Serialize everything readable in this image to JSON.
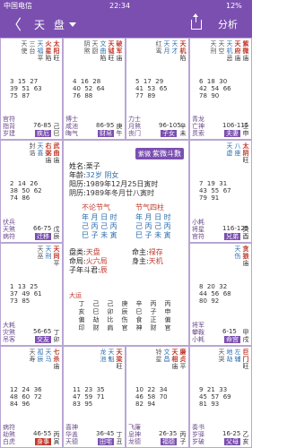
{
  "status": {
    "carrier": "中国电信",
    "time": "22:34",
    "battery": "12%"
  },
  "nav": {
    "back": "〈",
    "title": "天 盘",
    "analyze": "分析"
  },
  "center": {
    "logo_mark": "紫微",
    "logo_text": "紫微斗數",
    "name_label": "姓名:",
    "name": "栗子",
    "age_label": "年龄:",
    "age": "32岁 阴女",
    "solar_label": "阳历:",
    "solar": "1989年12月25日寅时",
    "lunar_label": "阴历:",
    "lunar": "1989年冬月廿八寅时",
    "box1_title": "不论节气",
    "box1_rows": [
      "年 月 日 时",
      "己 丙 己 丙",
      "巳 子 未 寅"
    ],
    "box2_title": "节气四柱",
    "box2_rows": [
      "年 月 日 时",
      "己 丙 己 丙",
      "巳 子 未 寅"
    ],
    "ju_label": "盘类:",
    "ju": "天盘",
    "ming_zhu_label": "命主:",
    "ming_zhu": "禄存",
    "ju2_label": "命局:",
    "ju2": "火六局",
    "shen_zhu_label": "身主:",
    "shen_zhu": "天机",
    "zidou_label": "子年斗君:",
    "zidou": "辰",
    "flow_label": "大运",
    "flow": [
      "丁",
      "己",
      "己",
      "庚",
      "辛",
      "丙",
      "丙",
      "亥",
      "巳",
      "卯",
      "辰",
      "巳",
      "子",
      "申",
      "偏",
      "劫",
      "比",
      "伤",
      "食",
      "正",
      "偏",
      "印",
      "财",
      "肩",
      "官",
      "神",
      "财",
      "官"
    ]
  },
  "cells": [
    {
      "key": "si",
      "stars": [
        [
          "太",
          "阳",
          "旺"
        ],
        [
          "火",
          "星",
          "陷"
        ],
        [
          "天",
          "福",
          "平"
        ],
        [
          "三",
          "台",
          ""
        ]
      ],
      "left": [
        "天",
        "使"
      ],
      "nums": "3  15  27\n39  51  63\n75  87",
      "gods": "官符\n指背\n岁建",
      "range": "76-85",
      "palace": "疾厄",
      "gz": "己巳"
    },
    {
      "key": "wu",
      "stars": [
        [
          "破",
          "军",
          "庙"
        ],
        [
          "天",
          "钺",
          "旺"
        ],
        [
          "文",
          "曲",
          "陷"
        ],
        [
          "天",
          "厨",
          ""
        ],
        [
          "阴",
          "煞",
          ""
        ]
      ],
      "left": [],
      "nums": "4  16  28\n40  52  64\n76  88",
      "gods": "博士\n咸池\n晦气",
      "range": "86-95",
      "palace": "财帛",
      "gz": "庚午"
    },
    {
      "key": "wei",
      "stars": [
        [
          "天",
          "机",
          "陷"
        ],
        [
          "天",
          "才",
          ""
        ],
        [
          "天",
          "月",
          ""
        ],
        [
          "红",
          "鸾",
          ""
        ]
      ],
      "left": [],
      "nums": "5  17  29\n41  53  65\n77  89",
      "gods": "力士\n月煞\n丧门",
      "range": "96-105",
      "palace": "子女",
      "gz": "辛未"
    },
    {
      "key": "shen",
      "stars": [
        [
          "紫",
          "微",
          "庙"
        ],
        [
          "天",
          "府",
          "庙"
        ],
        [
          "天",
          "机",
          "忌"
        ],
        [
          "天",
          "空",
          ""
        ]
      ],
      "left": [
        "天",
        "刑"
      ],
      "nums": "6  18  30\n42  54  66\n78  90",
      "gods": "青龙\n亡神\n贯索",
      "range": "106-115",
      "palace": "夫妻",
      "gz": "壬申"
    },
    {
      "key": "chen",
      "stars": [
        [
          "武",
          "曲",
          "庙"
        ],
        [
          "右",
          "弼",
          "庙"
        ],
        [
          "天",
          "喜",
          ""
        ]
      ],
      "left": [
        "封",
        "诰"
      ],
      "nums": "2  14  26\n38  50  62\n74  86",
      "gods": "伏兵\n天煞\n病符",
      "range": "66-75",
      "palace": "迁移",
      "gz": "戊辰"
    },
    {
      "key": "you",
      "stars": [
        [
          "太",
          "阴",
          "旺"
        ],
        [
          "八",
          "座",
          ""
        ],
        [
          "天",
          "虚",
          ""
        ]
      ],
      "left": [],
      "nums": "7  19  31\n43  55  67\n79  91",
      "gods": "小耗\n将星\n官符",
      "range": "116-125",
      "palace": "兄弟",
      "gz": "癸酉"
    },
    {
      "key": "mao",
      "stars": [
        [
          "天",
          "同",
          "平"
        ],
        [
          "天",
          "刑",
          ""
        ]
      ],
      "left": [
        "天",
        "巫"
      ],
      "nums": "1  13  25\n37  49  61\n73  85",
      "gods": "大耗\n灾煞\n吊客",
      "range": "56-65",
      "palace": "交友",
      "gz": "丁卯"
    },
    {
      "key": "xu",
      "stars": [
        [
          "贪",
          "狼",
          "庙"
        ],
        [
          "天",
          "伤",
          ""
        ]
      ],
      "left": [],
      "nums": "8  20  32\n44  56  68\n80  92",
      "gods": "将军\n攀鞍\n小耗",
      "range": "6-15",
      "palace": "命宫",
      "gz": "甲戌"
    },
    {
      "key": "yin",
      "stars": [
        [
          "七",
          "杀",
          "庙"
        ],
        [
          "天",
          "马",
          ""
        ],
        [
          "孤",
          "辰",
          ""
        ]
      ],
      "left": [
        "天",
        "寿"
      ],
      "nums": "12  24  36\n48  60  72\n84  96",
      "gods": "病符\n劫煞\n白虎",
      "range": "46-55",
      "palace": "身事",
      "gz": "丙寅",
      "bodyp": true
    },
    {
      "key": "chou",
      "stars": [
        [
          "天",
          "梁",
          "旺"
        ],
        [
          "天",
          "魁",
          ""
        ],
        [
          "龙",
          "池",
          ""
        ]
      ],
      "left": [],
      "nums": "11  23  35\n47  59  71\n83  95",
      "gods": "喜神\n华盖\n天德",
      "range": "36-45",
      "palace": "田宅",
      "gz": "丁丑"
    },
    {
      "key": "zi",
      "stars": [
        [
          "廉",
          "贞",
          "平"
        ],
        [
          "天",
          "相",
          "庙"
        ],
        [
          "文",
          "昌",
          ""
        ],
        [
          "铃",
          "星",
          ""
        ]
      ],
      "left": [],
      "nums": "10  22  34\n46  58  70\n82  94",
      "gods": "飞廉\n息神\n龙德",
      "range": "26-35",
      "palace": "福德",
      "gz": "丙子"
    },
    {
      "key": "hai",
      "stars": [
        [
          "巨",
          "门",
          "旺"
        ],
        [
          "左",
          "辅",
          ""
        ],
        [
          "地",
          "劫",
          ""
        ],
        [
          "天",
          "哭",
          ""
        ]
      ],
      "left": [],
      "nums": "9  21  33\n45  57  69\n81  93",
      "gods": "奏书\n岁驿\n岁破",
      "range": "16-25",
      "palace": "父母",
      "gz": "乙亥"
    }
  ]
}
